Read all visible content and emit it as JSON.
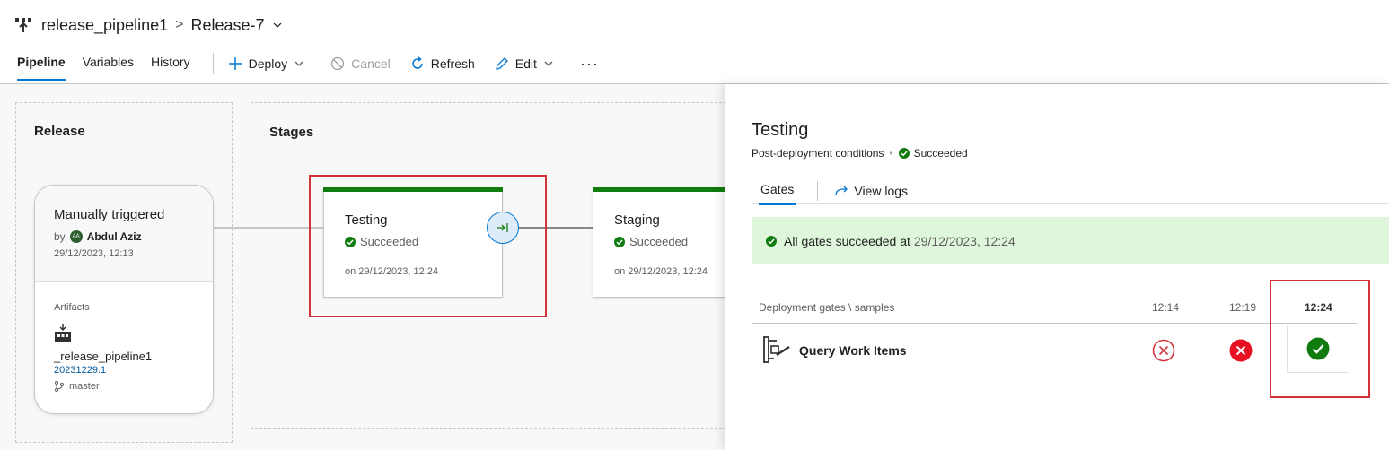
{
  "header": {
    "pipeline_name": "release_pipeline1",
    "breadcrumb_separator": ">",
    "release_name": "Release-7"
  },
  "tabs": [
    {
      "label": "Pipeline",
      "active": true
    },
    {
      "label": "Variables",
      "active": false
    },
    {
      "label": "History",
      "active": false
    }
  ],
  "toolbar": {
    "deploy": "Deploy",
    "cancel": "Cancel",
    "refresh": "Refresh",
    "edit": "Edit",
    "more": "···"
  },
  "release_section": {
    "title": "Release",
    "trigger": {
      "title": "Manually triggered",
      "by_label": "by",
      "avatar_initials": "AA",
      "user": "Abdul Aziz",
      "date": "29/12/2023, 12:13"
    },
    "artifacts": {
      "label": "Artifacts",
      "name": "_release_pipeline1",
      "build": "20231229.1",
      "branch": "master"
    }
  },
  "stages_section": {
    "title": "Stages",
    "stages": [
      {
        "name": "Testing",
        "status": "Succeeded",
        "date": "on 29/12/2023, 12:24"
      },
      {
        "name": "Staging",
        "status": "Succeeded",
        "date": "on 29/12/2023, 12:24"
      }
    ]
  },
  "panel": {
    "title": "Testing",
    "subtitle": "Post-deployment conditions",
    "subtitle_sep": "•",
    "status": "Succeeded",
    "tabs": {
      "gates": "Gates",
      "view_logs": "View logs"
    },
    "banner": {
      "text": "All gates succeeded at",
      "date": "29/12/2023, 12:24"
    },
    "gates_table": {
      "header_label": "Deployment gates \\ samples",
      "times": [
        "12:14",
        "12:19",
        "12:24"
      ],
      "rows": [
        {
          "name": "Query Work Items",
          "results": [
            "failed-outline",
            "failed",
            "succeeded"
          ]
        }
      ]
    }
  },
  "colors": {
    "accent": "#0078d4",
    "success": "#107c10",
    "error": "#d13438",
    "banner": "#dff6dd",
    "highlight_box": "#d13438"
  }
}
